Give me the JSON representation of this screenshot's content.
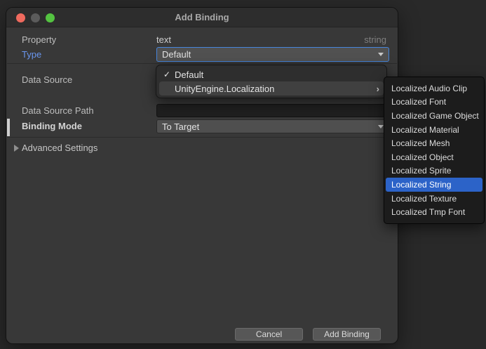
{
  "colors": {
    "page_bg": "#292929",
    "dialog_bg": "#383838",
    "titlebar_bg": "#2D2D2D",
    "accent_blue_text": "#6A96EE",
    "focus_border_blue": "#4685DB",
    "selection_blue": "#2C63C8",
    "traffic_close": "#EF6A5E",
    "traffic_minimize": "#5B5B5B",
    "traffic_zoom": "#54C341"
  },
  "window": {
    "title": "Add Binding"
  },
  "form": {
    "property": {
      "label": "Property",
      "value": "text",
      "type_hint": "string"
    },
    "type": {
      "label": "Type",
      "value": "Default"
    },
    "data_source": {
      "label": "Data Source"
    },
    "data_source_path": {
      "label": "Data Source Path",
      "value": "",
      "placeholder": ""
    },
    "binding_mode": {
      "label": "Binding Mode",
      "value": "To Target"
    },
    "advanced": {
      "label": "Advanced Settings"
    }
  },
  "type_menu": {
    "items": [
      {
        "label": "Default",
        "checked": true,
        "check_glyph": "✓"
      },
      {
        "label": "UnityEngine.Localization",
        "has_submenu": true,
        "submenu_glyph": "›",
        "highlighted": true
      }
    ]
  },
  "submenu": {
    "items": [
      "Localized Audio Clip",
      "Localized Font",
      "Localized Game Object",
      "Localized Material",
      "Localized Mesh",
      "Localized Object",
      "Localized Sprite",
      "Localized String",
      "Localized Texture",
      "Localized Tmp Font"
    ],
    "selected": "Localized String"
  },
  "footer": {
    "cancel_label": "Cancel",
    "add_label": "Add Binding"
  }
}
